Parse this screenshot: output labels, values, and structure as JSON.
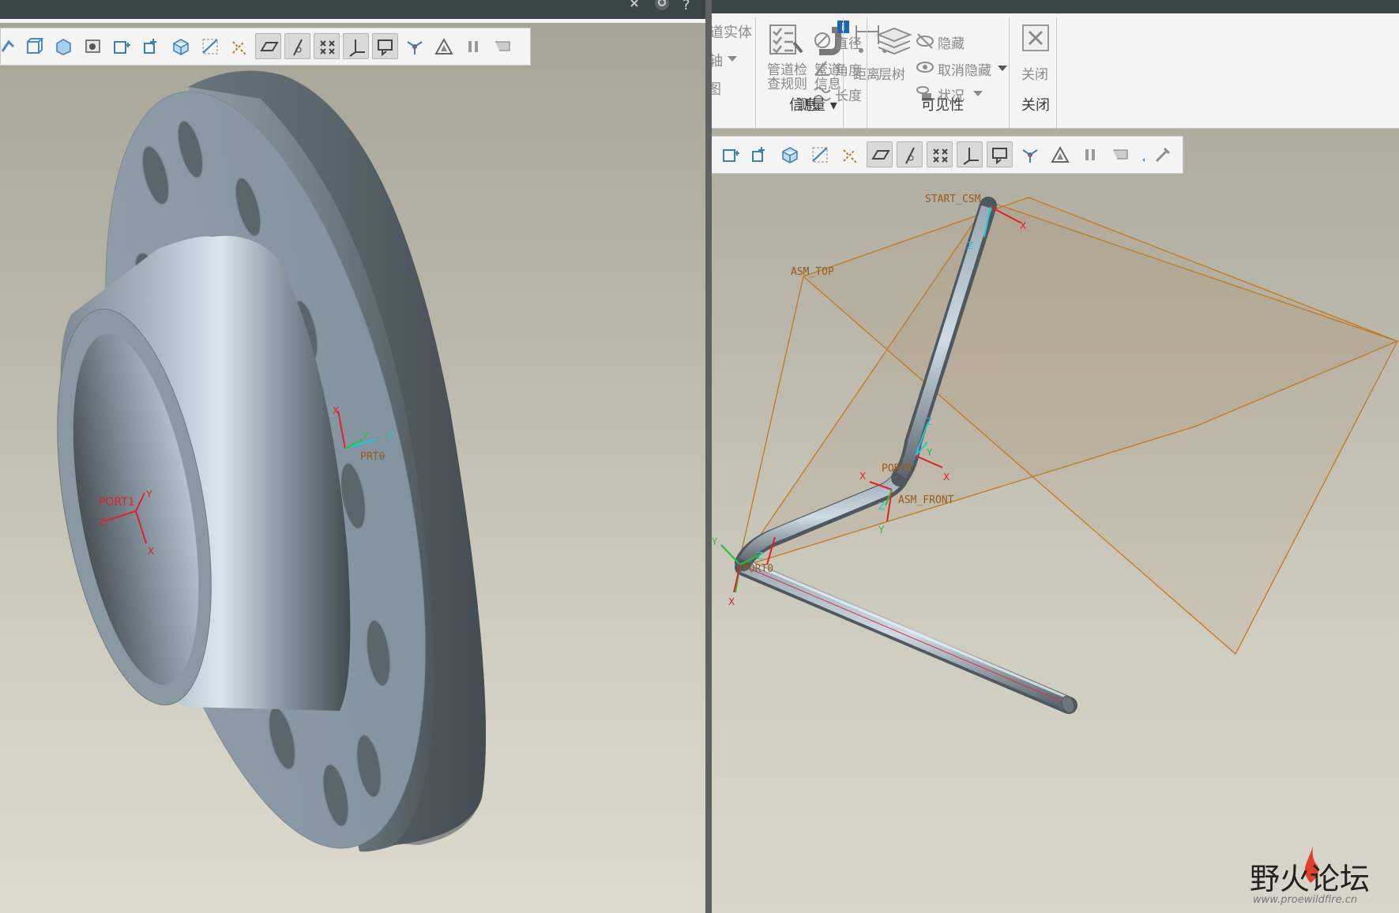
{
  "colors": {
    "title_bar": "#3a4548",
    "model_blue": "#8d9ba4",
    "datum": "#c4781c",
    "axis_red": "#e0202a",
    "axis_cyan": "#22c6d8",
    "axis_green": "#26c23a"
  },
  "left_window": {
    "title_icons": [
      "close-icon",
      "search-icon",
      "help-icon"
    ],
    "help_symbol": "?",
    "toolbar_icons": [
      "sketch-icon",
      "box-icon",
      "shaded-box-icon",
      "camera-icon",
      "view-icon",
      "refit-icon",
      "cube-icon",
      "plane-icon",
      "axis-icon",
      "plane-display-icon",
      "axis-display-icon",
      "point-display-icon",
      "csys-display-icon",
      "annotation-icon",
      "spin-center-icon",
      "triangle-icon",
      "pause-icon",
      "flag-icon"
    ],
    "viewport_labels": {
      "port1": "PORT1",
      "port0": "PRT0",
      "x": "X",
      "y": "Y",
      "z": "Z"
    }
  },
  "right_window": {
    "ribbon": {
      "partial_items": [
        "道实体",
        "轴",
        "图"
      ],
      "info": {
        "check_rules": "管道检\n查规则",
        "pipe_info": "管道\n信息",
        "group_label": "信息"
      },
      "measure": {
        "distance": "距离",
        "diameter": "直径",
        "angle": "角度",
        "length": "长度",
        "group_label": "测量 ▾"
      },
      "visibility": {
        "layer_tree": "层树",
        "hide": "隐藏",
        "unhide": "取消隐藏",
        "status": "状况",
        "group_label": "可见性"
      },
      "close": {
        "close": "关闭",
        "group_label": "关闭"
      },
      "info_badge": "i"
    },
    "toolbar_icons": [
      "box-icon",
      "refit-icon",
      "cube-icon",
      "plane-icon",
      "axis-icon",
      "plane-display-icon",
      "axis-display-icon",
      "point-display-icon",
      "csys-display-icon",
      "annotation-icon",
      "spin-center-icon",
      "triangle-icon",
      "pause-icon",
      "flag-icon",
      "pen-icon",
      "settings-icon"
    ],
    "viewport_labels": {
      "start": "START_CSM",
      "asm_top": "ASM_TOP",
      "port0": "PORT0",
      "asm_front": "ASM_FRONT",
      "port0b": "PORT0",
      "x": "X",
      "y": "Y",
      "z": "Z"
    }
  },
  "watermark": {
    "title": "野火论坛",
    "url": "www.proewildfire.cn"
  }
}
